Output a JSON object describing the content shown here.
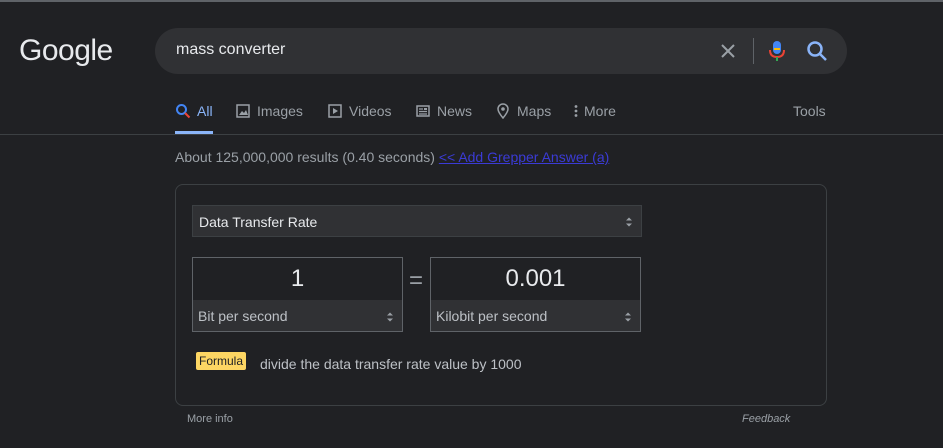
{
  "header": {
    "logo_text": "Google",
    "search_query": "mass converter"
  },
  "icons": {
    "clear": "close-icon",
    "mic": "microphone-icon",
    "search": "search-icon"
  },
  "tabs": [
    {
      "label": "All",
      "icon": "search-icon",
      "active": true
    },
    {
      "label": "Images",
      "icon": "image-icon",
      "active": false
    },
    {
      "label": "Videos",
      "icon": "play-icon",
      "active": false
    },
    {
      "label": "News",
      "icon": "newspaper-icon",
      "active": false
    },
    {
      "label": "Maps",
      "icon": "map-pin-icon",
      "active": false
    },
    {
      "label": "More",
      "icon": "more-vert-icon",
      "active": false
    }
  ],
  "tools_label": "Tools",
  "results": {
    "stats": "About 125,000,000 results (0.40 seconds)",
    "grepper_link": "<< Add Grepper Answer (a)"
  },
  "converter": {
    "category": "Data Transfer Rate",
    "from_value": "1",
    "from_unit": "Bit per second",
    "equals": "=",
    "to_value": "0.001",
    "to_unit": "Kilobit per second",
    "formula_label": "Formula",
    "formula_text": "divide the data transfer rate value by 1000"
  },
  "footer": {
    "more_info": "More info",
    "feedback": "Feedback"
  },
  "colors": {
    "background": "#202124",
    "active_tab": "#8ab4f8",
    "formula_badge": "#fdd663"
  }
}
